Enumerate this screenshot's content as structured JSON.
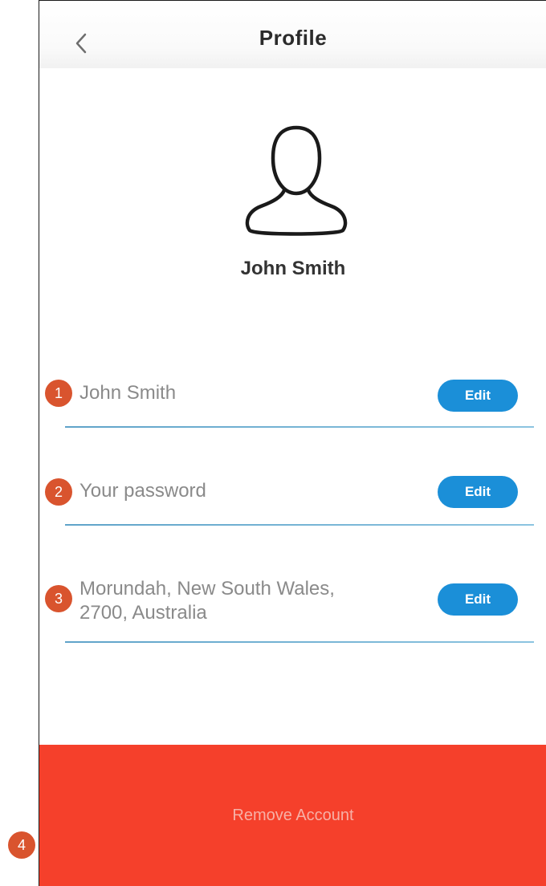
{
  "header": {
    "title": "Profile",
    "back_icon": "chevron-left-icon"
  },
  "profile": {
    "avatar_icon": "user-icon",
    "name": "John Smith"
  },
  "fields": [
    {
      "label": "John Smith",
      "edit_label": "Edit"
    },
    {
      "label": "Your password",
      "edit_label": "Edit"
    },
    {
      "label_line1": "Morundah, New South Wales,",
      "label_line2": "2700, Australia",
      "edit_label": "Edit"
    }
  ],
  "remove_account": {
    "label": "Remove Account"
  },
  "markers": [
    "1",
    "2",
    "3",
    "4"
  ],
  "colors": {
    "accent": "#1b8fd8",
    "danger": "#f5402b",
    "marker": "#d9542e"
  }
}
